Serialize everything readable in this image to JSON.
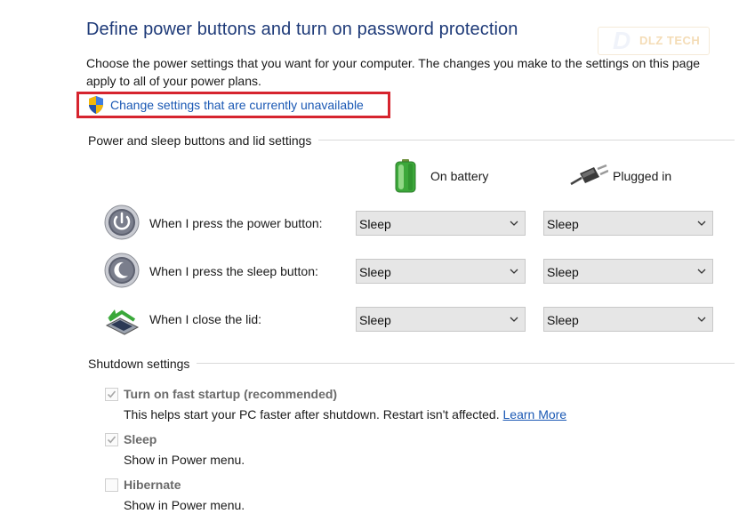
{
  "header": {
    "title": "Define power buttons and turn on password protection",
    "intro": "Choose the power settings that you want for your computer. The changes you make to the settings on this page apply to all of your power plans.",
    "change_link": "Change settings that are currently unavailable"
  },
  "watermark": {
    "mark": "D",
    "text": "DLZ TECH"
  },
  "power_section": {
    "title": "Power and sleep buttons and lid settings",
    "col_battery": "On battery",
    "col_plugged": "Plugged in",
    "rows": [
      {
        "label": "When I press the power button:",
        "icon": "power-button-icon",
        "battery": "Sleep",
        "plugged": "Sleep"
      },
      {
        "label": "When I press the sleep button:",
        "icon": "sleep-button-icon",
        "battery": "Sleep",
        "plugged": "Sleep"
      },
      {
        "label": "When I close the lid:",
        "icon": "laptop-lid-icon",
        "battery": "Sleep",
        "plugged": "Sleep"
      }
    ]
  },
  "shutdown_section": {
    "title": "Shutdown settings",
    "fast_startup": {
      "label": "Turn on fast startup (recommended)",
      "desc": "This helps start your PC faster after shutdown. Restart isn't affected.",
      "link": "Learn More",
      "checked": true
    },
    "sleep": {
      "label": "Sleep",
      "desc": "Show in Power menu.",
      "checked": true
    },
    "hibernate": {
      "label": "Hibernate",
      "desc": "Show in Power menu.",
      "checked": false
    }
  },
  "colors": {
    "title": "#1e3a78",
    "link": "#1a58b4",
    "highlight": "#d6242e"
  }
}
